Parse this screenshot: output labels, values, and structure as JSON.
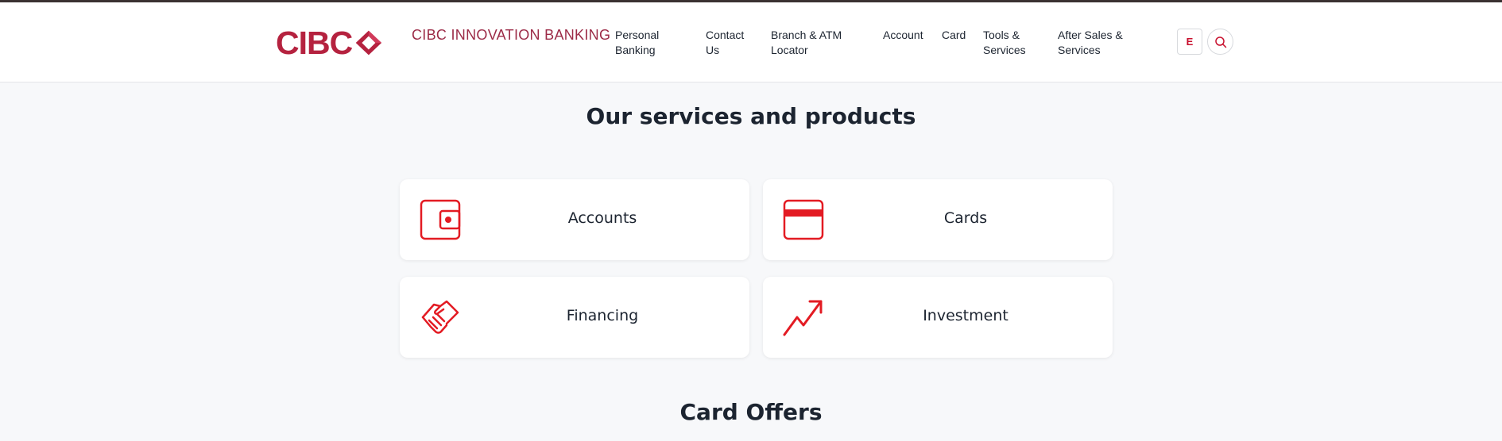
{
  "header": {
    "logo_text": "CIBC",
    "brand_name": "CIBC INNOVATION BANKING",
    "nav": [
      {
        "label": "Personal Banking"
      },
      {
        "label": "Contact Us"
      },
      {
        "label": "Branch & ATM Locator"
      },
      {
        "label": "Account"
      },
      {
        "label": "Card"
      },
      {
        "label": "Tools & Services"
      },
      {
        "label": "After Sales & Services"
      }
    ],
    "language_button": "E",
    "search_icon": "search-icon"
  },
  "services": {
    "title": "Our services and products",
    "items": [
      {
        "label": "Accounts",
        "icon": "wallet-icon"
      },
      {
        "label": "Cards",
        "icon": "credit-card-icon"
      },
      {
        "label": "Financing",
        "icon": "handshake-icon"
      },
      {
        "label": "Investment",
        "icon": "trending-up-icon"
      }
    ]
  },
  "offers": {
    "title": "Card Offers"
  },
  "colors": {
    "brand": "#b5223f",
    "accent_red": "#e31b23",
    "text": "#1c2430",
    "background": "#f7f8fa"
  }
}
